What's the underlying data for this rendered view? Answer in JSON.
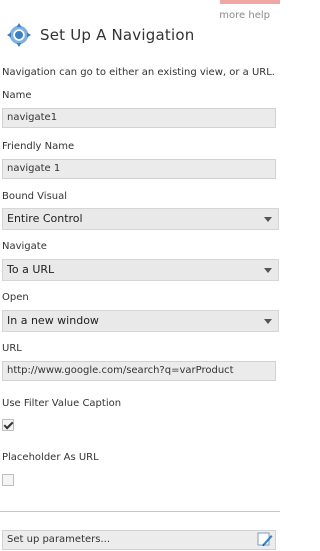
{
  "more_help": "more help",
  "title": "Set Up A Navigation",
  "description": "Navigation can go to either an existing view, or a URL.",
  "name": {
    "label": "Name",
    "value": "navigate1"
  },
  "friendly_name": {
    "label": "Friendly Name",
    "value": "navigate 1"
  },
  "bound_visual": {
    "label": "Bound Visual",
    "selected": "Entire Control"
  },
  "navigate": {
    "label": "Navigate",
    "selected": "To a URL"
  },
  "open": {
    "label": "Open",
    "selected": "In a new window"
  },
  "url": {
    "label": "URL",
    "value": "http://www.google.com/search?q=varProduct"
  },
  "use_filter_value_caption": {
    "label": "Use Filter Value Caption",
    "checked": true
  },
  "placeholder_as_url": {
    "label": "Placeholder As URL",
    "checked": false
  },
  "setup_parameters": {
    "label": "Set up parameters..."
  },
  "colors": {
    "accent": "#f2a7a7",
    "icon_blue": "#3a7fc1",
    "field_bg": "#ebebeb"
  },
  "icons": {
    "header": "navigation-compass-icon",
    "parameters": "pencil-edit-icon",
    "dropdown": "chevron-down-icon"
  }
}
